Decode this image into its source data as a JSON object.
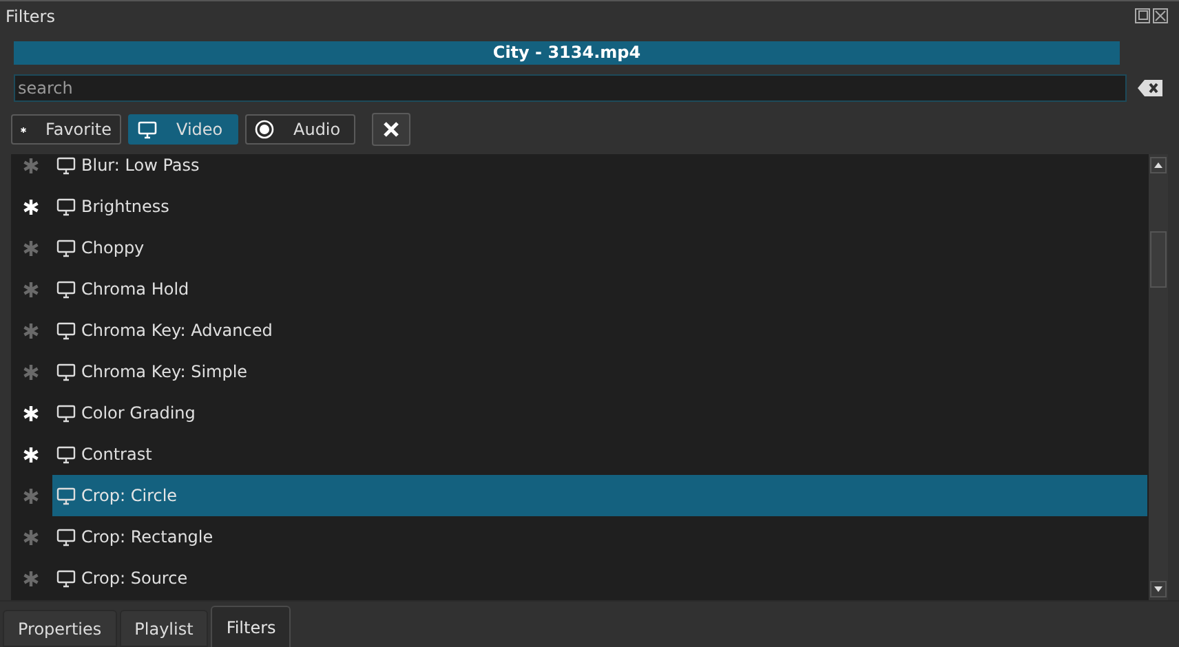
{
  "window": {
    "title": "Filters"
  },
  "clip": {
    "name": "City - 3134.mp4"
  },
  "search": {
    "placeholder": "search"
  },
  "filter_buttons": [
    {
      "kind": "favorite",
      "label": "Favorite",
      "selected": false
    },
    {
      "kind": "video",
      "label": "Video",
      "selected": true
    },
    {
      "kind": "audio",
      "label": "Audio",
      "selected": false
    }
  ],
  "filters": [
    {
      "name": "Blur: Low Pass",
      "favorite": false,
      "selected": false
    },
    {
      "name": "Brightness",
      "favorite": true,
      "selected": false
    },
    {
      "name": "Choppy",
      "favorite": false,
      "selected": false
    },
    {
      "name": "Chroma Hold",
      "favorite": false,
      "selected": false
    },
    {
      "name": "Chroma Key: Advanced",
      "favorite": false,
      "selected": false
    },
    {
      "name": "Chroma Key: Simple",
      "favorite": false,
      "selected": false
    },
    {
      "name": "Color Grading",
      "favorite": true,
      "selected": false
    },
    {
      "name": "Contrast",
      "favorite": true,
      "selected": false
    },
    {
      "name": "Crop: Circle",
      "favorite": false,
      "selected": true
    },
    {
      "name": "Crop: Rectangle",
      "favorite": false,
      "selected": false
    },
    {
      "name": "Crop: Source",
      "favorite": false,
      "selected": false
    }
  ],
  "bottom_tabs": [
    {
      "label": "Properties",
      "selected": false
    },
    {
      "label": "Playlist",
      "selected": false
    },
    {
      "label": "Filters",
      "selected": true
    }
  ]
}
